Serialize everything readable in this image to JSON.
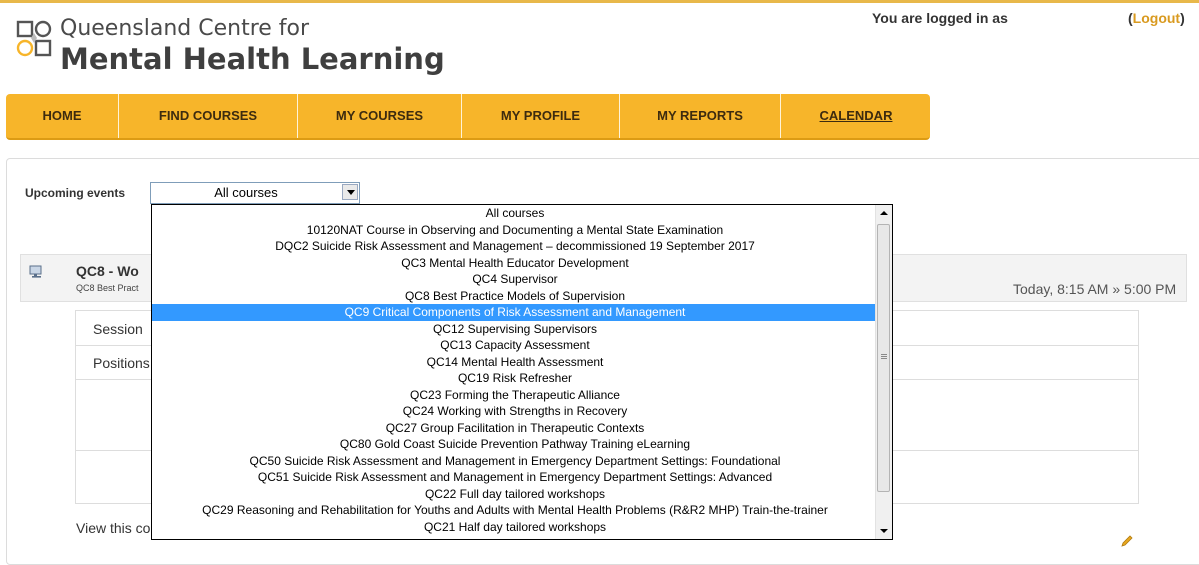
{
  "header": {
    "logo_line1": "Queensland Centre for",
    "logo_line2": "Mental Health Learning",
    "logged_in_text": "You are logged in as",
    "logout_label": "Logout",
    "logout_paren_open": "(",
    "logout_paren_close": ")"
  },
  "nav": {
    "items": [
      {
        "label": "HOME"
      },
      {
        "label": "FIND COURSES"
      },
      {
        "label": "MY COURSES"
      },
      {
        "label": "MY PROFILE"
      },
      {
        "label": "MY REPORTS"
      },
      {
        "label": "CALENDAR",
        "active": true
      }
    ]
  },
  "upcoming": {
    "label": "Upcoming events",
    "selected": "All courses",
    "options": [
      "All courses",
      "10120NAT Course in Observing and Documenting a Mental State Examination",
      "DQC2 Suicide Risk Assessment and Management – decommissioned 19 September 2017",
      "QC3 Mental Health Educator Development",
      "QC4 Supervisor",
      "QC8 Best Practice Models of Supervision",
      "QC9 Critical Components of Risk Assessment and Management",
      "QC12 Supervising Supervisors",
      "QC13 Capacity Assessment",
      "QC14 Mental Health Assessment",
      "QC19 Risk Refresher",
      "QC23 Forming the Therapeutic Alliance",
      "QC24 Working with Strengths in Recovery",
      "QC27 Group Facilitation in Therapeutic Contexts",
      "QC80 Gold Coast Suicide Prevention Pathway Training eLearning",
      "QC50 Suicide Risk Assessment and Management in Emergency Department Settings: Foundational",
      "QC51 Suicide Risk Assessment and Management in Emergency Department Settings: Advanced",
      "QC22 Full day tailored workshops",
      "QC29 Reasoning and Rehabilitation for Youths and Adults with Mental Health Problems (R&R2 MHP) Train-the-trainer",
      "QC21 Half day tailored workshops"
    ],
    "highlighted_index": 6
  },
  "event": {
    "title": "QC8 - Wo",
    "subtitle": "QC8 Best Pract",
    "time_day": "Today",
    "time_rest": ", 8:15 AM » 5:00 PM",
    "rows": [
      "Session",
      "Positions"
    ],
    "view_text": "View this co"
  },
  "colors": {
    "nav_bg": "#f7b52a",
    "logout_link": "#d99a1f",
    "selected_option": "#3399ff"
  }
}
